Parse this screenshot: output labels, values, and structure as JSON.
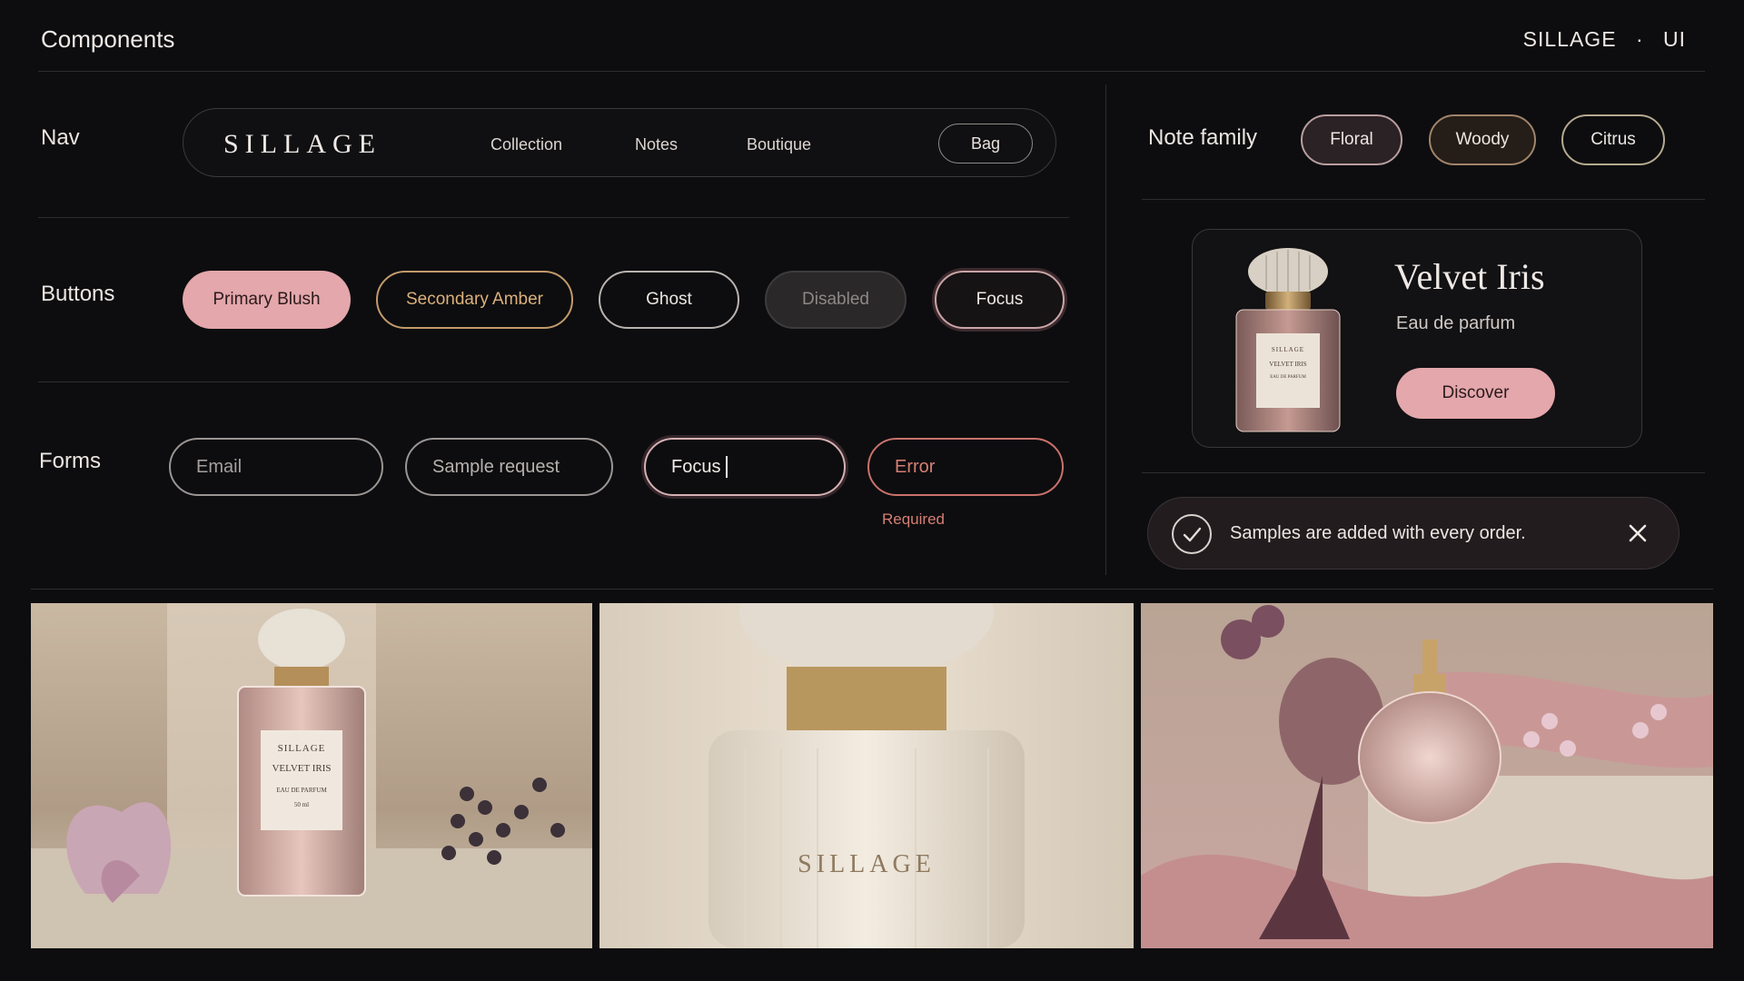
{
  "header": {
    "title": "Components",
    "brand": "SILLAGE",
    "separator": "·",
    "suffix": "UI"
  },
  "sections": {
    "nav": "Nav",
    "buttons": "Buttons",
    "forms": "Forms",
    "note_family": "Note family"
  },
  "nav": {
    "logo": "SILLAGE",
    "links": [
      "Collection",
      "Notes",
      "Boutique"
    ],
    "bag": "Bag"
  },
  "buttons": {
    "primary": "Primary Blush",
    "secondary": "Secondary Amber",
    "ghost": "Ghost",
    "disabled": "Disabled",
    "focus": "Focus"
  },
  "forms": {
    "email_placeholder": "Email",
    "sample_placeholder": "Sample request",
    "focus_value": "Focus",
    "error_value": "Error",
    "error_message": "Required"
  },
  "chips": [
    "Floral",
    "Woody",
    "Citrus"
  ],
  "product": {
    "title": "Velvet Iris",
    "subtitle": "Eau de parfum",
    "cta": "Discover",
    "label_brand": "SILLAGE",
    "label_name": "VELVET IRIS",
    "label_type": "EAU DE PARFUM",
    "label_volume": "50 ml"
  },
  "toast": {
    "message": "Samples are added with every order."
  },
  "photos": {
    "bottle_brand": "SILLAGE"
  },
  "colors": {
    "background": "#0d0d0f",
    "blush": "#e4a7ab",
    "amber": "#c39a6b",
    "error": "#c9726b"
  }
}
